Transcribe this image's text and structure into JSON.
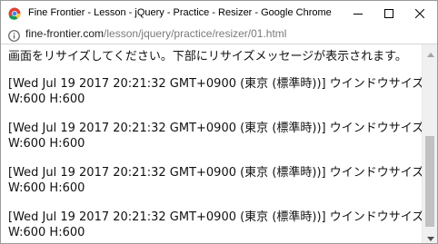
{
  "window": {
    "title": "Fine Frontier - Lesson - jQuery - Practice - Resizer - Google Chrome"
  },
  "address_bar": {
    "url_host": "fine-frontier.com",
    "url_path": "/lesson/jquery/practice/resizer/01.html"
  },
  "page": {
    "intro_text": "画面をリサイズしてください。下部にリサイズメッセージが表示されます。",
    "log_entries": [
      {
        "timestamp": "[Wed Jul 19 2017 20:21:32 GMT+0900 (東京 (標準時))]",
        "message": "ウインドウサイズ",
        "size": "W:600 H:600"
      },
      {
        "timestamp": "[Wed Jul 19 2017 20:21:32 GMT+0900 (東京 (標準時))]",
        "message": "ウインドウサイズ",
        "size": "W:600 H:600"
      },
      {
        "timestamp": "[Wed Jul 19 2017 20:21:32 GMT+0900 (東京 (標準時))]",
        "message": "ウインドウサイズ",
        "size": "W:600 H:600"
      },
      {
        "timestamp": "[Wed Jul 19 2017 20:21:32 GMT+0900 (東京 (標準時))]",
        "message": "ウインドウサイズ",
        "size": "W:600 H:600"
      }
    ]
  },
  "icons": {
    "app": "chrome-icon",
    "minimize": "minimize-icon",
    "maximize": "maximize-icon",
    "close": "close-icon",
    "info": "info-icon",
    "scroll_up": "scroll-up-arrow-icon",
    "scroll_down": "scroll-down-arrow-icon"
  },
  "colors": {
    "url_host": "#202020",
    "url_path": "#7a7a7a",
    "scrollbar_track": "#f0f0f0",
    "scrollbar_thumb": "#c1c1c1"
  }
}
